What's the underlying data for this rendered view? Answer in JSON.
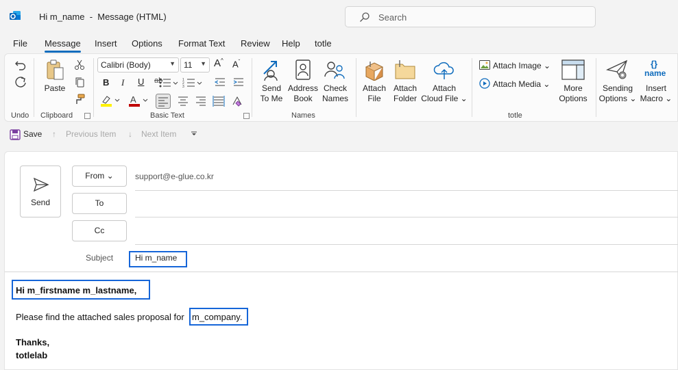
{
  "window": {
    "title": "Hi m_name  -  Message (HTML)",
    "search_placeholder": "Search"
  },
  "menu_tabs": [
    "File",
    "Message",
    "Insert",
    "Options",
    "Format Text",
    "Review",
    "Help",
    "totle"
  ],
  "active_tab": "Message",
  "ribbon": {
    "undo_label": "Undo",
    "clipboard": {
      "paste": "Paste",
      "group": "Clipboard"
    },
    "basic_text": {
      "font": "Calibri (Body)",
      "size": "11",
      "group": "Basic Text"
    },
    "names": {
      "send_to_me": [
        "Send",
        "To Me"
      ],
      "address_book": [
        "Address",
        "Book"
      ],
      "check_names": [
        "Check",
        "Names"
      ],
      "group": "Names"
    },
    "totle": {
      "attach_file": [
        "Attach",
        "File"
      ],
      "attach_folder": [
        "Attach",
        "Folder"
      ],
      "attach_cloud": [
        "Attach",
        "Cloud File ⌄"
      ],
      "attach_image": "Attach Image ⌄",
      "attach_media": "Attach Media ⌄",
      "more_options": [
        "More",
        "Options"
      ],
      "sending_options": [
        "Sending",
        "Options ⌄"
      ],
      "insert_macro": [
        "Insert",
        "Macro ⌄"
      ],
      "macro_icon_text": "name",
      "group": "totle"
    }
  },
  "quick_access": {
    "save": "Save",
    "previous_item": "Previous Item",
    "next_item": "Next Item"
  },
  "compose": {
    "send": "Send",
    "from_label": "From ⌄",
    "from_address": "support@e-glue.co.kr",
    "to_label": "To",
    "cc_label": "Cc",
    "subject_label": "Subject",
    "subject_value": "Hi m_name",
    "body": {
      "greeting": "Hi m_firstname m_lastname,",
      "line1_prefix": "Please find the attached sales proposal for",
      "line1_field": "m_company.",
      "closing": "Thanks,",
      "signature": "totlelab"
    }
  },
  "colors": {
    "accent": "#0f6cbd",
    "highlight_box": "#1565d8",
    "highlight_yellow": "#fff100",
    "font_red": "#c00000"
  }
}
